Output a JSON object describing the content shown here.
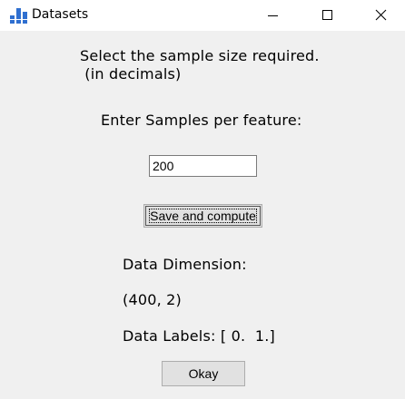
{
  "window": {
    "title": "Datasets",
    "icon": "bar-chart-icon",
    "controls": {
      "minimize": "minimize-icon",
      "maximize": "maximize-icon",
      "close": "close-icon"
    }
  },
  "form": {
    "prompt_line1": "Select the sample size required.",
    "prompt_line2": " (in decimals)",
    "samples_label": "Enter Samples per feature:",
    "samples_value": "200",
    "save_button": "Save and compute"
  },
  "results": {
    "dimension_label": "Data Dimension:",
    "dimension_value": "(400, 2)",
    "labels_text": "Data Labels: [ 0.  1.]"
  },
  "footer": {
    "okay_button": "Okay"
  },
  "colors": {
    "titlebar": "#ffffff",
    "background": "#f0f0f0",
    "button_face": "#e1e1e1",
    "icon_blue": "#2f6fd0"
  }
}
